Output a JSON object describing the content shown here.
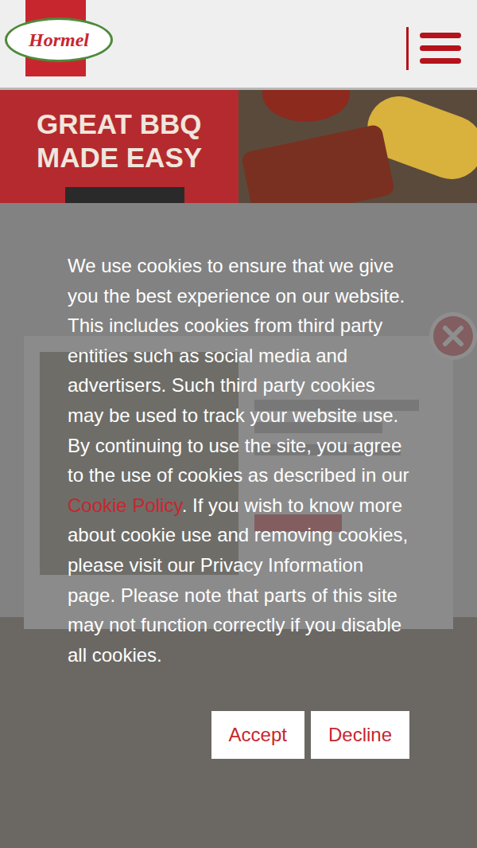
{
  "header": {
    "logo": "Hormel",
    "menu_open": false
  },
  "banner": {
    "lines": [
      "GREAT BBQ",
      "MADE EASY"
    ]
  },
  "cookie_notice": {
    "text_before": "We use cookies to ensure that we give you the best experience on our website. This includes cookies from third party entities such as social media and advertisers. Such third party cookies may be used to track your website use. By continuing to use the site, you agree to the use of cookies as described in our ",
    "link": "Cookie Policy",
    "text_after": ". If you wish to know more about cookie use and removing cookies, please visit our Privacy Information page. Please note that parts of this site may not function correctly if you disable all cookies."
  },
  "buttons": [
    "Accept",
    "Decline"
  ]
}
